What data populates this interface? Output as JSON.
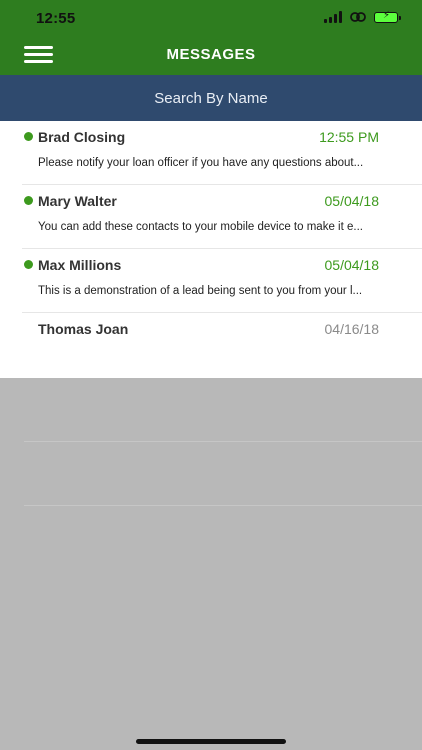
{
  "status_bar": {
    "time": "12:55",
    "icons": [
      "signal-icon",
      "link-icon",
      "battery-charging-icon"
    ]
  },
  "header": {
    "title": "MESSAGES",
    "menu_icon": "hamburger-menu-icon",
    "background_color": "#2e7d1f"
  },
  "search": {
    "label": "Search By Name",
    "background_color": "#2f4a6e"
  },
  "messages": [
    {
      "name": "Brad Closing",
      "time": "12:55 PM",
      "preview": "Please notify your loan officer if you have any questions about...",
      "unread": true
    },
    {
      "name": "Mary Walter",
      "time": "05/04/18",
      "preview": "You can add these contacts to your mobile device to make it e...",
      "unread": true
    },
    {
      "name": "Max Millions",
      "time": "05/04/18",
      "preview": "This is a demonstration of a lead being sent to you from your l...",
      "unread": true
    },
    {
      "name": "Thomas Joan",
      "time": "04/16/18",
      "preview": "",
      "unread": false
    }
  ],
  "colors": {
    "unread_accent": "#3d9a1e",
    "read_time": "#8a8a8a"
  }
}
